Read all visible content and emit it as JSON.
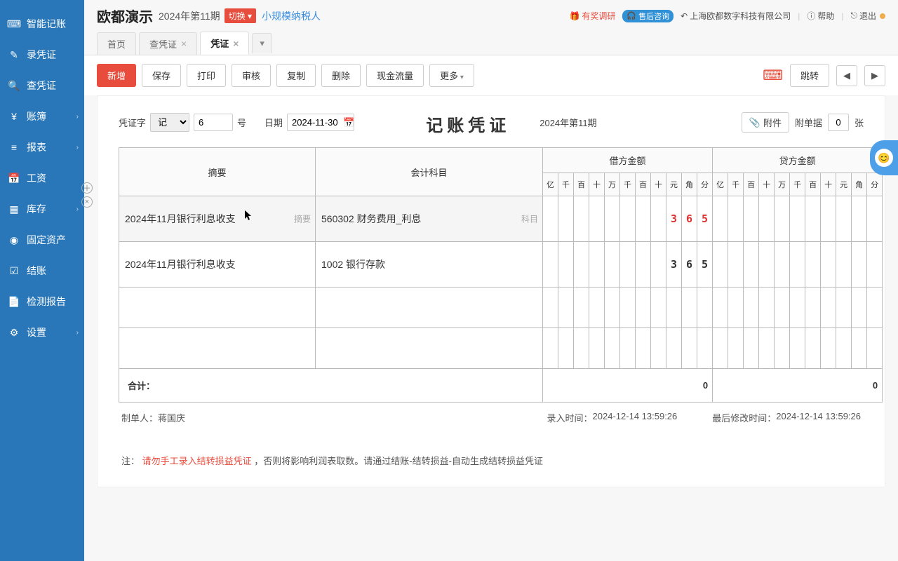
{
  "sidebar": {
    "items": [
      {
        "label": "智能记账",
        "icon": "⌨",
        "chevron": false
      },
      {
        "label": "录凭证",
        "icon": "✎",
        "chevron": false
      },
      {
        "label": "查凭证",
        "icon": "🔍",
        "chevron": false
      },
      {
        "label": "账簿",
        "icon": "¥",
        "chevron": true
      },
      {
        "label": "报表",
        "icon": "≡",
        "chevron": true
      },
      {
        "label": "工资",
        "icon": "📅",
        "chevron": false
      },
      {
        "label": "库存",
        "icon": "▦",
        "chevron": true
      },
      {
        "label": "固定资产",
        "icon": "◉",
        "chevron": false
      },
      {
        "label": "结账",
        "icon": "☑",
        "chevron": false
      },
      {
        "label": "检测报告",
        "icon": "📄",
        "chevron": false
      },
      {
        "label": "设置",
        "icon": "⚙",
        "chevron": true
      }
    ]
  },
  "header": {
    "title": "欧都演示",
    "period": "2024年第11期",
    "switch": "切换",
    "tax_type": "小规模纳税人",
    "links": {
      "survey": "有奖调研",
      "after_sales": "售后咨询",
      "company": "上海欧都数字科技有限公司",
      "help": "帮助",
      "logout": "退出"
    }
  },
  "tabs": [
    {
      "label": "首页",
      "closable": false
    },
    {
      "label": "查凭证",
      "closable": true
    },
    {
      "label": "凭证",
      "closable": true,
      "active": true
    }
  ],
  "toolbar": {
    "new": "新增",
    "save": "保存",
    "print": "打印",
    "audit": "审核",
    "copy": "复制",
    "delete": "删除",
    "cashflow": "现金流量",
    "more": "更多",
    "jump": "跳转"
  },
  "voucher": {
    "prefix_label": "凭证字",
    "prefix_value": "记",
    "number_value": "6",
    "number_suffix": "号",
    "date_label": "日期",
    "date_value": "2024-11-30",
    "title": "记账凭证",
    "period": "2024年第11期",
    "attach_btn": "附件",
    "attach_label": "附单据",
    "attach_value": "0",
    "attach_unit": "张",
    "columns": {
      "summary": "摘要",
      "account": "会计科目",
      "debit": "借方金额",
      "credit": "贷方金额"
    },
    "units": [
      "亿",
      "千",
      "百",
      "十",
      "万",
      "千",
      "百",
      "十",
      "元",
      "角",
      "分"
    ],
    "rows": [
      {
        "summary": "2024年11月银行利息收支",
        "account": "560302 财务费用_利息",
        "summary_tag": "摘要",
        "account_tag": "科目",
        "debit": [
          "",
          "",
          "",
          "",
          "",
          "",
          "",
          "",
          "3",
          "6",
          "5"
        ],
        "credit": [
          "",
          "",
          "",
          "",
          "",
          "",
          "",
          "",
          "",
          "",
          ""
        ],
        "active": true,
        "debit_red": true
      },
      {
        "summary": "2024年11月银行利息收支",
        "account": "1002 银行存款",
        "debit": [
          "",
          "",
          "",
          "",
          "",
          "",
          "",
          "",
          "3",
          "6",
          "5"
        ],
        "credit": [
          "",
          "",
          "",
          "",
          "",
          "",
          "",
          "",
          "",
          "",
          ""
        ],
        "active": false,
        "debit_red": false
      }
    ],
    "total_label": "合计：",
    "total_debit_right": "0",
    "total_credit_right": "0",
    "maker_label": "制单人：",
    "maker_name": "蒋国庆",
    "entry_time_label": "录入时间：",
    "entry_time": "2024-12-14 13:59:26",
    "modify_time_label": "最后修改时间：",
    "modify_time": "2024-12-14 13:59:26",
    "note_prefix": "注：",
    "note_red": "请勿手工录入结转损益凭证",
    "note_rest": "，否则将影响利润表取数。请通过结账-结转损益-自动生成结转损益凭证"
  }
}
